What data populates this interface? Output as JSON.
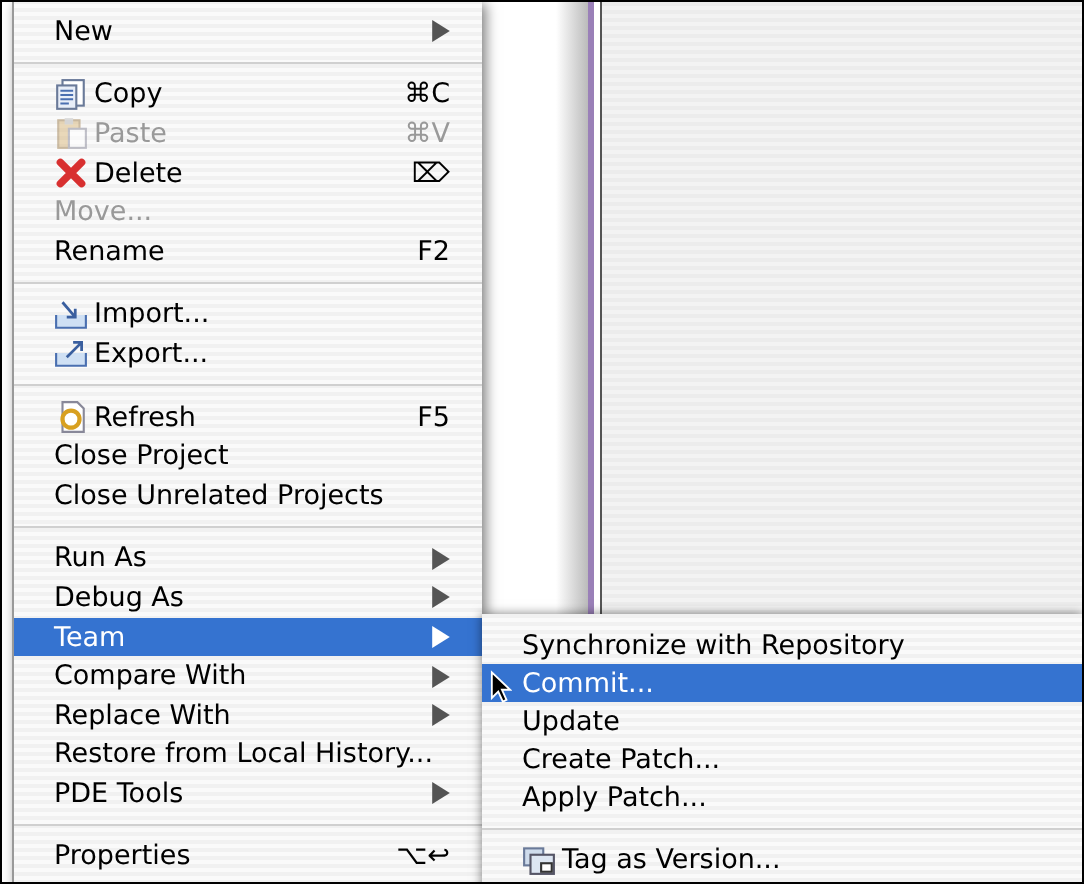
{
  "context_menu": {
    "sections": [
      [
        {
          "label": "New",
          "kind": "plain",
          "has_submenu": true,
          "disabled": false,
          "selected": false
        }
      ],
      [
        {
          "label": "Copy",
          "kind": "copy",
          "shortcut": "⌘C",
          "has_submenu": false,
          "disabled": false,
          "selected": false
        },
        {
          "label": "Paste",
          "kind": "paste",
          "shortcut": "⌘V",
          "has_submenu": false,
          "disabled": true,
          "selected": false
        },
        {
          "label": "Delete",
          "kind": "delete",
          "shortcut": "⌦",
          "has_submenu": false,
          "disabled": false,
          "selected": false
        },
        {
          "label": "Move...",
          "kind": "plain",
          "has_submenu": false,
          "disabled": true,
          "selected": false
        },
        {
          "label": "Rename",
          "kind": "plain",
          "shortcut": "F2",
          "has_submenu": false,
          "disabled": false,
          "selected": false
        }
      ],
      [
        {
          "label": "Import...",
          "kind": "import",
          "has_submenu": false,
          "disabled": false,
          "selected": false
        },
        {
          "label": "Export...",
          "kind": "export",
          "has_submenu": false,
          "disabled": false,
          "selected": false
        }
      ],
      [
        {
          "label": "Refresh",
          "kind": "refresh",
          "shortcut": "F5",
          "has_submenu": false,
          "disabled": false,
          "selected": false
        },
        {
          "label": "Close Project",
          "kind": "plain",
          "has_submenu": false,
          "disabled": false,
          "selected": false
        },
        {
          "label": "Close Unrelated Projects",
          "kind": "plain",
          "has_submenu": false,
          "disabled": false,
          "selected": false
        }
      ],
      [
        {
          "label": "Run As",
          "kind": "plain",
          "has_submenu": true,
          "disabled": false,
          "selected": false
        },
        {
          "label": "Debug As",
          "kind": "plain",
          "has_submenu": true,
          "disabled": false,
          "selected": false
        },
        {
          "label": "Team",
          "kind": "plain",
          "has_submenu": true,
          "disabled": false,
          "selected": true
        },
        {
          "label": "Compare With",
          "kind": "plain",
          "has_submenu": true,
          "disabled": false,
          "selected": false
        },
        {
          "label": "Replace With",
          "kind": "plain",
          "has_submenu": true,
          "disabled": false,
          "selected": false
        },
        {
          "label": "Restore from Local History...",
          "kind": "plain",
          "has_submenu": false,
          "disabled": false,
          "selected": false
        },
        {
          "label": "PDE Tools",
          "kind": "plain",
          "has_submenu": true,
          "disabled": false,
          "selected": false
        }
      ],
      [
        {
          "label": "Properties",
          "kind": "plain",
          "shortcut": "⌥↩",
          "has_submenu": false,
          "disabled": false,
          "selected": false
        }
      ]
    ]
  },
  "team_submenu": {
    "sections": [
      [
        {
          "label": "Synchronize with Repository",
          "kind": "plain",
          "selected": false
        },
        {
          "label": "Commit...",
          "kind": "plain",
          "selected": true
        },
        {
          "label": "Update",
          "kind": "plain",
          "selected": false
        },
        {
          "label": "Create Patch...",
          "kind": "plain",
          "selected": false
        },
        {
          "label": "Apply Patch...",
          "kind": "plain",
          "selected": false
        }
      ],
      [
        {
          "label": "Tag as Version...",
          "kind": "tag",
          "selected": false
        }
      ]
    ]
  }
}
